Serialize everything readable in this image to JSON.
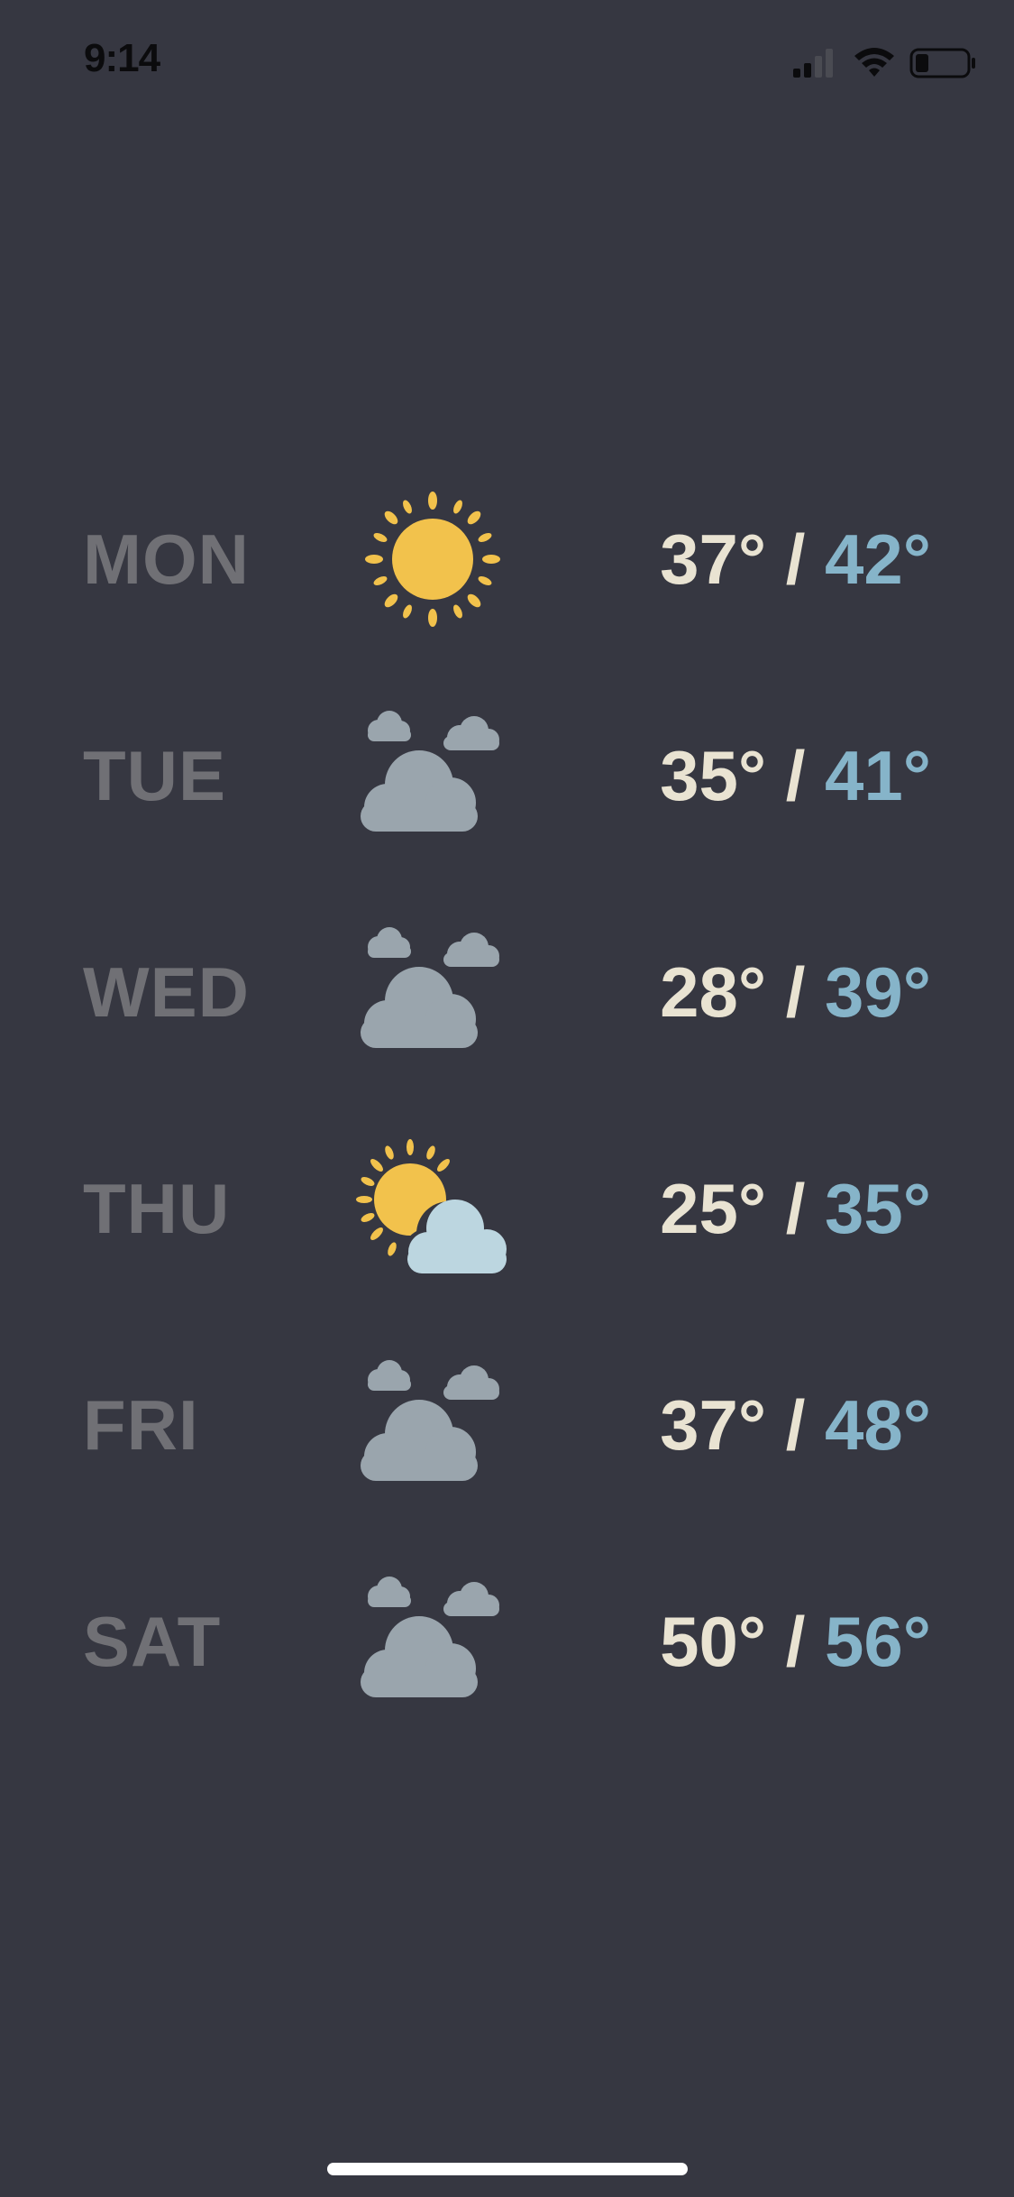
{
  "status_bar": {
    "time": "9:14",
    "icons": [
      "cellular-signal-icon",
      "wifi-icon",
      "battery-icon"
    ]
  },
  "forecast": [
    {
      "day": "MON",
      "icon": "sun-icon",
      "low": "37°",
      "high": "42°"
    },
    {
      "day": "TUE",
      "icon": "cloudy-icon",
      "low": "35°",
      "high": "41°"
    },
    {
      "day": "WED",
      "icon": "cloudy-icon",
      "low": "28°",
      "high": "39°"
    },
    {
      "day": "THU",
      "icon": "partly-cloudy-icon",
      "low": "25°",
      "high": "35°"
    },
    {
      "day": "FRI",
      "icon": "cloudy-icon",
      "low": "37°",
      "high": "48°"
    },
    {
      "day": "SAT",
      "icon": "cloudy-icon",
      "low": "50°",
      "high": "56°"
    }
  ],
  "separator": "/",
  "colors": {
    "background": "#363741",
    "day_label": "#707075",
    "low_temp": "#e9e3d2",
    "high_temp": "#86b4c9",
    "sun": "#f2c24c",
    "cloud": "#9aa5ad",
    "cloud_light": "#bcd6e0"
  }
}
